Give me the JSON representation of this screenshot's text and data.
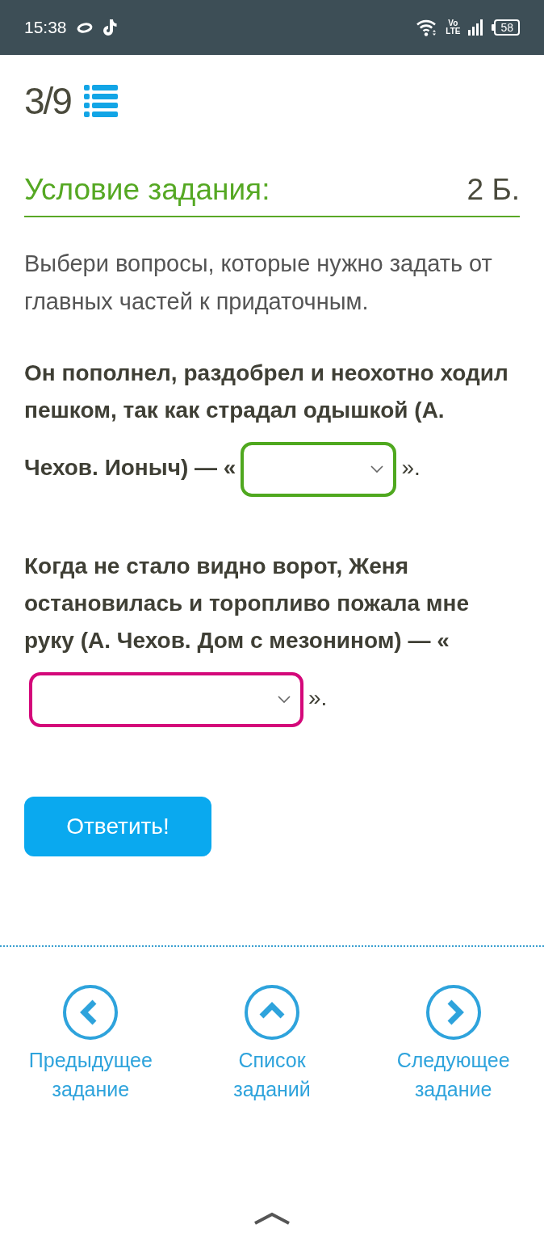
{
  "status_bar": {
    "time": "15:38",
    "network_label": "Vo\nLTE",
    "battery": "58"
  },
  "header": {
    "counter": "3/9"
  },
  "task": {
    "title": "Условие задания:",
    "points": "2 Б.",
    "instruction": "Выбери вопросы, которые нужно задать от главных частей к придаточным.",
    "sentences": [
      {
        "text": "Он пополнел, раздобрел и неохотно ходил пешком, так как страдал одышкой (А. Чехов. Ионыч) — «",
        "dropdown": {
          "color": "#4fa81f"
        },
        "closing": "»."
      },
      {
        "text": "Когда не стало видно ворот, Женя остановилась и торопливо пожала мне руку (А. Чехов. Дом с мезонином) — «",
        "dropdown": {
          "color": "#d4087a"
        },
        "closing": "»."
      }
    ]
  },
  "submit_button": "Ответить!",
  "navigation": [
    {
      "kind": "previous",
      "label": "Предыдущее задание"
    },
    {
      "kind": "list",
      "label": "Список заданий"
    },
    {
      "kind": "next",
      "label": "Следующее задание"
    }
  ]
}
